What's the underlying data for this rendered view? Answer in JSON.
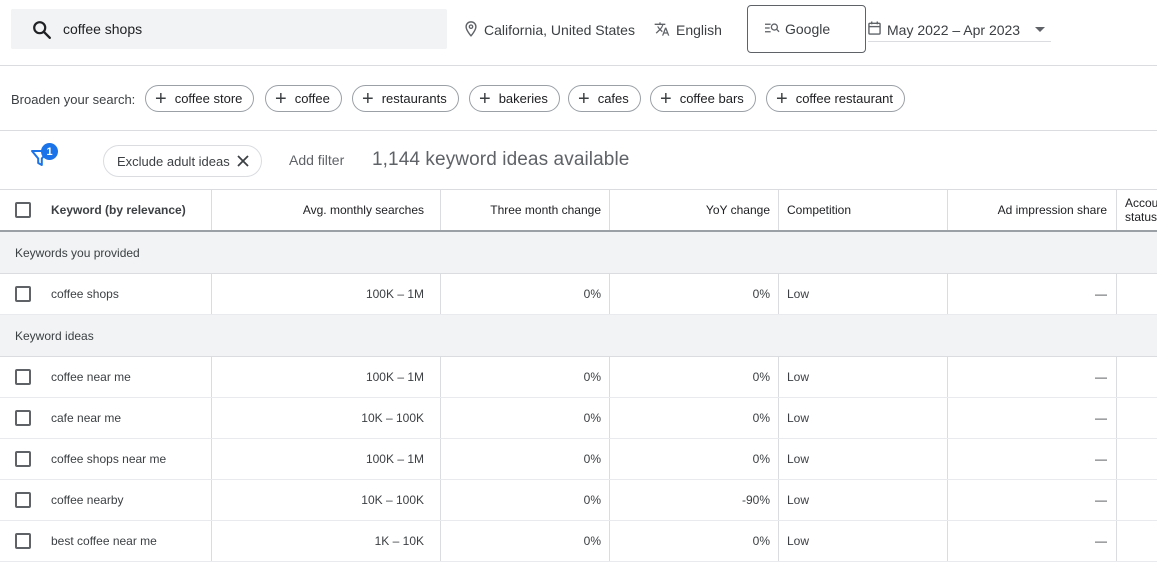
{
  "search": {
    "value": "coffee shops"
  },
  "location": "California, United States",
  "language": "English",
  "engine": "Google",
  "date_range": "May 2022 – Apr 2023",
  "broaden": {
    "label": "Broaden your search:",
    "chips": [
      "coffee store",
      "coffee",
      "restaurants",
      "bakeries",
      "cafes",
      "coffee bars",
      "coffee restaurant"
    ]
  },
  "filters": {
    "badge": "1",
    "active_chip": "Exclude adult ideas",
    "add_filter": "Add filter",
    "count_text": "1,144 keyword ideas available"
  },
  "table": {
    "headers": {
      "keyword": "Keyword (by relevance)",
      "avg": "Avg. monthly searches",
      "three": "Three month change",
      "yoy": "YoY change",
      "competition": "Competition",
      "ad_share": "Ad impression share",
      "account": "Account status"
    },
    "provided_label": "Keywords you provided",
    "provided": [
      {
        "keyword": "coffee shops",
        "avg": "100K – 1M",
        "three": "0%",
        "yoy": "0%",
        "competition": "Low",
        "ad_share": "—"
      }
    ],
    "ideas_label": "Keyword ideas",
    "ideas": [
      {
        "keyword": "coffee near me",
        "avg": "100K – 1M",
        "three": "0%",
        "yoy": "0%",
        "competition": "Low",
        "ad_share": "—"
      },
      {
        "keyword": "cafe near me",
        "avg": "10K – 100K",
        "three": "0%",
        "yoy": "0%",
        "competition": "Low",
        "ad_share": "—"
      },
      {
        "keyword": "coffee shops near me",
        "avg": "100K – 1M",
        "three": "0%",
        "yoy": "0%",
        "competition": "Low",
        "ad_share": "—"
      },
      {
        "keyword": "coffee nearby",
        "avg": "10K – 100K",
        "three": "0%",
        "yoy": "-90%",
        "competition": "Low",
        "ad_share": "—"
      },
      {
        "keyword": "best coffee near me",
        "avg": "1K – 10K",
        "three": "0%",
        "yoy": "0%",
        "competition": "Low",
        "ad_share": "—"
      }
    ]
  }
}
